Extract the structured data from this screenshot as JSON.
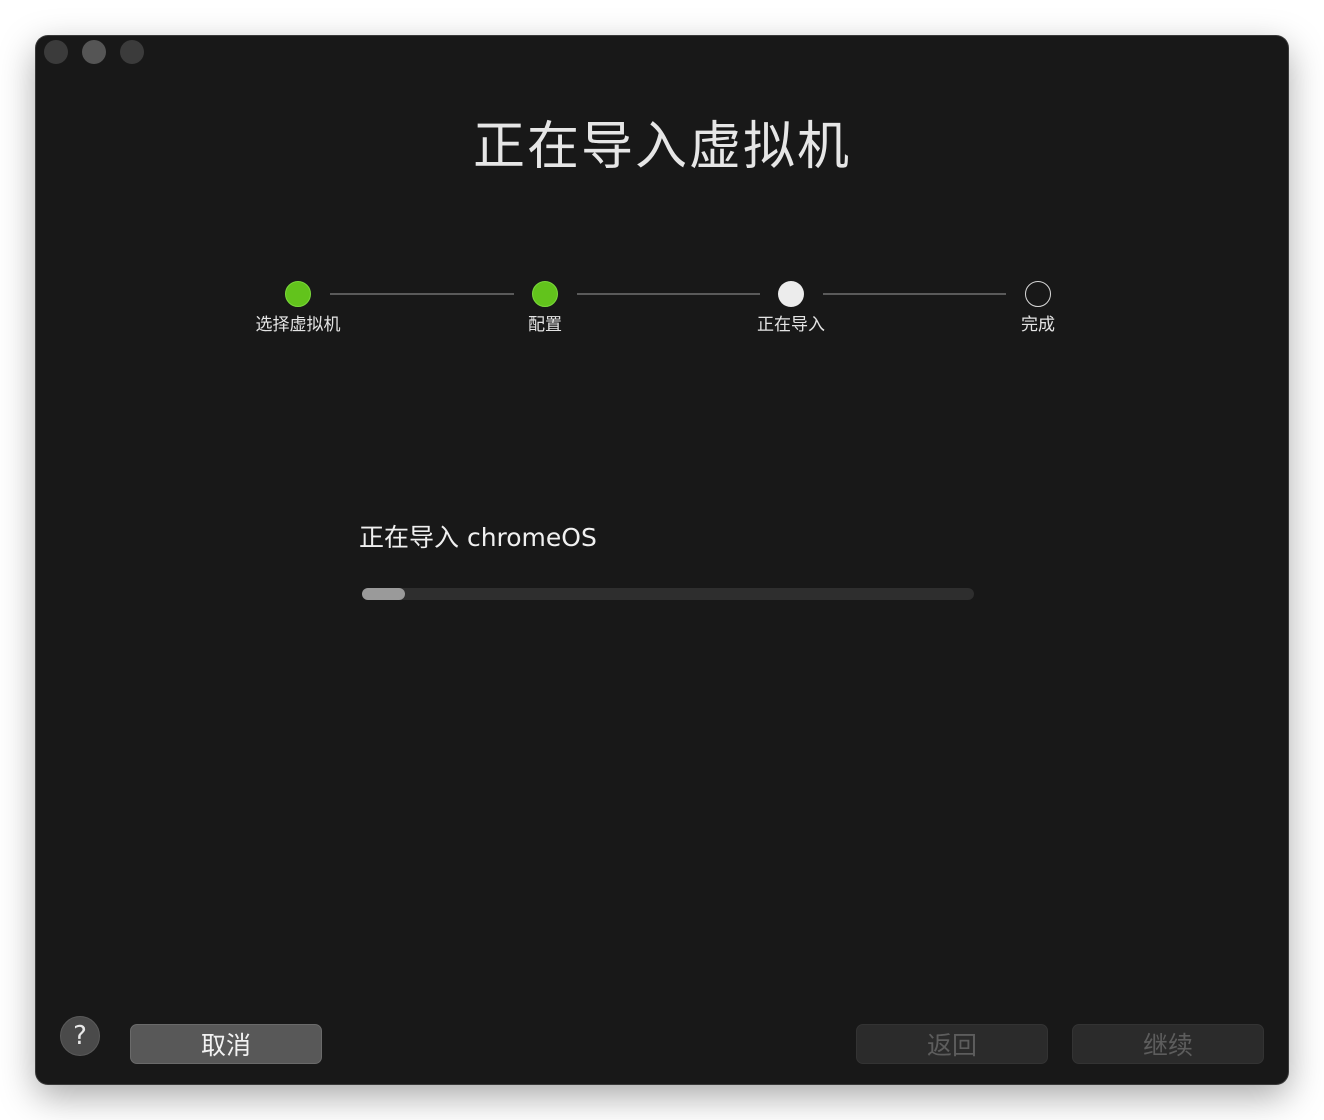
{
  "window": {
    "title": "正在导入虚拟机"
  },
  "stepper": {
    "steps": [
      {
        "label": "选择虚拟机",
        "state": "done"
      },
      {
        "label": "配置",
        "state": "done"
      },
      {
        "label": "正在导入",
        "state": "current"
      },
      {
        "label": "完成",
        "state": "todo"
      }
    ]
  },
  "import": {
    "status_text": "正在导入 chromeOS",
    "progress_fraction": 0.07
  },
  "buttons": {
    "help_label": "?",
    "cancel_label": "取消",
    "back_label": "返回",
    "continue_label": "继续"
  },
  "colors": {
    "done": "#62c31c",
    "background": "#181818"
  },
  "icons": {
    "help": "question-mark-icon"
  }
}
